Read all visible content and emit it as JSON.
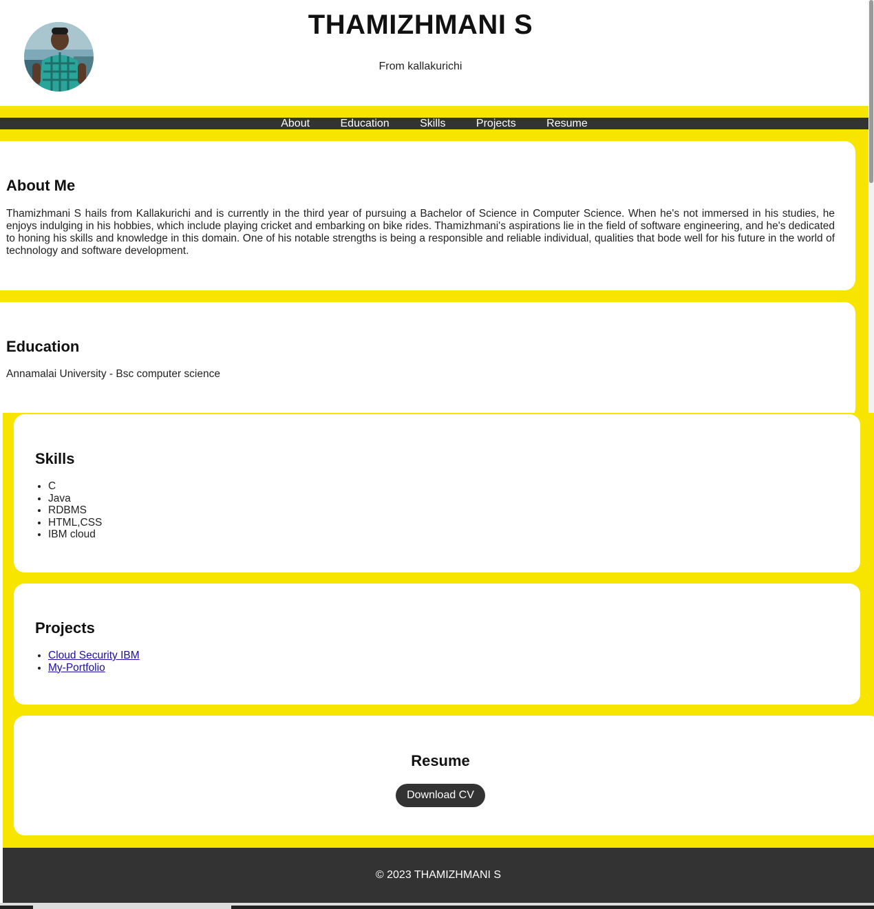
{
  "header": {
    "title": "THAMIZHMANI S",
    "subtitle": "From kallakurichi"
  },
  "nav": {
    "items": [
      "About",
      "Education",
      "Skills",
      "Projects",
      "Resume"
    ]
  },
  "about": {
    "heading": "About Me",
    "text": "Thamizhmani S hails from Kallakurichi and is currently in the third year of pursuing a Bachelor of Science in Computer Science. When he's not immersed in his studies, he enjoys indulging in his hobbies, which include playing cricket and embarking on bike rides. Thamizhmani's aspirations lie in the field of software engineering, and he's dedicated to honing his skills and knowledge in this domain. One of his notable strengths is being a responsible and reliable individual, qualities that bode well for his future in the world of technology and software development."
  },
  "education": {
    "heading": "Education",
    "text": "Annamalai University - Bsc computer science"
  },
  "skills": {
    "heading": "Skills",
    "items": [
      "C",
      "Java",
      "RDBMS",
      "HTML,CSS",
      "IBM cloud"
    ]
  },
  "projects": {
    "heading": "Projects",
    "items": [
      "Cloud Security IBM",
      "My-Portfolio"
    ]
  },
  "resume": {
    "heading": "Resume",
    "button_label": "Download CV"
  },
  "footer": {
    "text": "© 2023 THAMIZHMANI S"
  },
  "colors": {
    "accent": "#f7e500",
    "dark": "#333333",
    "link": "#1a0dab"
  }
}
